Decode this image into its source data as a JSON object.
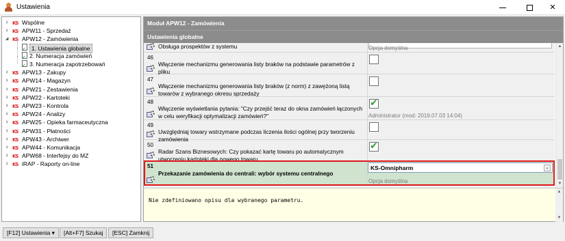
{
  "window": {
    "title": "Ustawienia",
    "icons": {
      "minimize": "minimize-icon",
      "maximize": "maximize-icon",
      "close": "close-icon"
    },
    "close_glyph": "✕"
  },
  "tree": {
    "items": [
      {
        "label": "Wspólne",
        "level": 0,
        "expanded": false
      },
      {
        "label": "APW11 - Sprzedaż",
        "level": 0,
        "expanded": false
      },
      {
        "label": "APW12 - Zamówienia",
        "level": 0,
        "expanded": true
      },
      {
        "label": "1. Ustawienia globalne",
        "level": 1,
        "selected": true
      },
      {
        "label": "2. Numeracja zamówień",
        "level": 1
      },
      {
        "label": "3. Numeracja zapotrzebowań",
        "level": 1
      },
      {
        "label": "APW13 - Zakupy",
        "level": 0,
        "expanded": false
      },
      {
        "label": "APW14 - Magazyn",
        "level": 0,
        "expanded": false
      },
      {
        "label": "APW21 - Zestawienia",
        "level": 0,
        "expanded": false
      },
      {
        "label": "APW22 - Kartoteki",
        "level": 0,
        "expanded": false
      },
      {
        "label": "APW23 - Kontrola",
        "level": 0,
        "expanded": false
      },
      {
        "label": "APW24 - Analizy",
        "level": 0,
        "expanded": false
      },
      {
        "label": "APW25 - Opieka farmaceutyczna",
        "level": 0,
        "expanded": false
      },
      {
        "label": "APW31 - Płatności",
        "level": 0,
        "expanded": false
      },
      {
        "label": "APW43 - Archiwer",
        "level": 0,
        "expanded": false
      },
      {
        "label": "APW44 - Komunikacja",
        "level": 0,
        "expanded": false
      },
      {
        "label": "APW68 - Interfejsy do MZ",
        "level": 0,
        "expanded": false
      },
      {
        "label": "iRAP - Raporty on-line",
        "level": 0,
        "expanded": false
      }
    ],
    "module_icon_text": "KS"
  },
  "panel": {
    "module_header": "Moduł APW12 - Zamówienia",
    "section_header": "Ustawienia globalne"
  },
  "params": [
    {
      "num": "",
      "text": "Obsługa prospektów z systemu",
      "control": "input",
      "value": "",
      "status": "Opcja domyślna"
    },
    {
      "num": "46",
      "text": "Włączenie mechanizmu generowania listy braków na podstawie parametrów z pliku",
      "control": "checkbox",
      "checked": false,
      "status": ""
    },
    {
      "num": "47",
      "text": "Włączenie mechanizmu generowania listy braków (z norm) z zawężoną listą towarów z wybranego okresu sprzedaży",
      "control": "checkbox",
      "checked": false,
      "status": ""
    },
    {
      "num": "48",
      "text": "Włączenie wyświetlania pytania: \"Czy przejść teraz do okna zamówień łączonych w celu weryfikacji optymalizacji zamówień?\"",
      "control": "checkbox",
      "checked": true,
      "status": "Administrator   (mod: 2019.07.03 14:04)"
    },
    {
      "num": "49",
      "text": "Uwzględniaj towary wstrzymane podczas liczenia ilości ogólnej przy tworzeniu zamówienia",
      "control": "checkbox",
      "checked": false,
      "status": ""
    },
    {
      "num": "50",
      "text": "Radar Szans Biznesowych: Czy pokazać kartę towaru po automatycznym utworzeniu kartoteki dla nowego towaru",
      "control": "checkbox",
      "checked": true,
      "status": ""
    },
    {
      "num": "51",
      "text": "Przekazanie zamówienia do centrali: wybór systemu centralnego",
      "control": "select",
      "value": "KS-Omnipharm",
      "status": "Opcja domyślna"
    }
  ],
  "check_glyph": "✔",
  "description": "Nie zdefiniowano opisu dla wybranego parametru.",
  "buttons": {
    "f12": "[F12] Ustawienia ▾",
    "search": "[Alt+F7] Szukaj",
    "close": "[ESC] Zamknij"
  },
  "colors": {
    "header_bg": "#8c8c8c",
    "active_row_bg": "#cfe3cf",
    "highlight_border": "#e01818",
    "check_green": "#3c9a3c",
    "ks_red": "#d22222"
  }
}
